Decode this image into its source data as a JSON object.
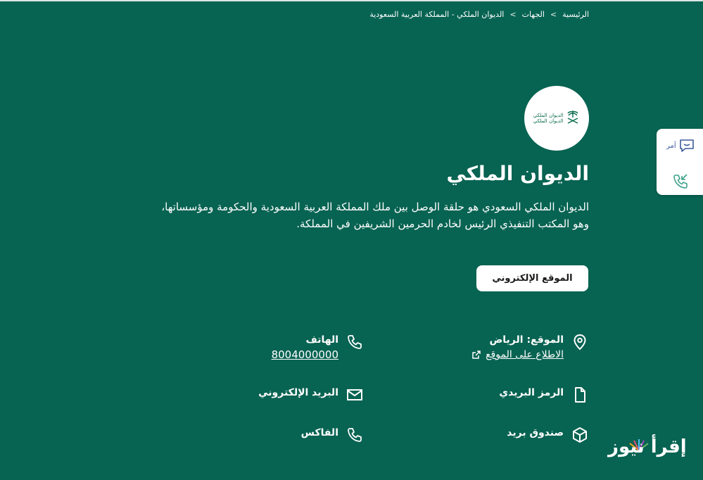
{
  "breadcrumb": {
    "home": "الرئيسية",
    "entities": "الجهات",
    "current": "الديوان الملكي - المملكة العربية السعودية",
    "separator": ">"
  },
  "logo": {
    "line1": "الديوان الملكي",
    "line2": "الديوان الملكي"
  },
  "title": "الديوان الملكي",
  "description": "الديوان الملكي السعودي هو حلقة الوصل بين ملك المملكة العربية السعودية والحكومة ومؤسساتها، وهو المكتب التنفيذي الرئيس لخادم الحرمين الشريفين في المملكة.",
  "website_button": "الموقع الإلكتروني",
  "location": {
    "label": "الموقع: الرياض",
    "link": "الاطلاع على الموقع"
  },
  "phone": {
    "label": "الهاتف",
    "value": "8004000000"
  },
  "postal_code": {
    "label": "الرمز البريدي"
  },
  "email": {
    "label": "البريد الإلكتروني"
  },
  "po_box": {
    "label": "صندوق بريد"
  },
  "fax": {
    "label": "الفاكس"
  },
  "side_panel": {
    "amer_label": "آمر"
  },
  "watermark": "إقرأ نيوز",
  "colors": {
    "background": "#076352",
    "text": "#ffffff",
    "accent_side": "#3c5a9c"
  }
}
